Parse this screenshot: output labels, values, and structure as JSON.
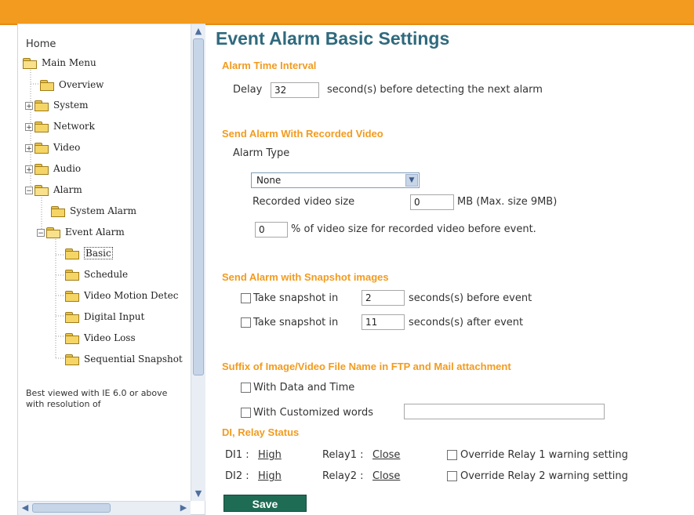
{
  "sidebar": {
    "home": "Home",
    "tree": [
      {
        "label": "Main Menu",
        "expander": ""
      },
      {
        "label": "Overview",
        "expander": ""
      },
      {
        "label": "System",
        "expander": "+"
      },
      {
        "label": "Network",
        "expander": "+"
      },
      {
        "label": "Video",
        "expander": "+"
      },
      {
        "label": "Audio",
        "expander": "+"
      },
      {
        "label": "Alarm",
        "expander": "−"
      },
      {
        "label": "System Alarm",
        "expander": ""
      },
      {
        "label": "Event Alarm",
        "expander": "−"
      },
      {
        "label": "Basic",
        "expander": ""
      },
      {
        "label": "Schedule",
        "expander": ""
      },
      {
        "label": "Video Motion Detec",
        "expander": ""
      },
      {
        "label": "Digital Input",
        "expander": ""
      },
      {
        "label": "Video Loss",
        "expander": ""
      },
      {
        "label": "Sequential Snapshot",
        "expander": ""
      }
    ],
    "note": "Best viewed with IE 6.0 or above with resolution of"
  },
  "main": {
    "title": "Event Alarm Basic Settings",
    "alarm_time": {
      "heading": "Alarm Time Interval",
      "delay_label": "Delay",
      "delay_value": "32",
      "delay_suffix": "second(s) before detecting the next alarm"
    },
    "recorded_video": {
      "heading": "Send Alarm With Recorded Video",
      "alarm_type_label": "Alarm Type",
      "alarm_type_value": "None",
      "size_label": "Recorded video size",
      "size_value": "0",
      "size_suffix": "MB (Max. size 9MB)",
      "percent_value": "0",
      "percent_suffix": "% of video size for recorded video before event."
    },
    "snapshot": {
      "heading": "Send Alarm with Snapshot images",
      "before_label": "Take snapshot in",
      "before_value": "2",
      "before_suffix": "seconds(s) before event",
      "after_label": "Take snapshot in",
      "after_value": "11",
      "after_suffix": "seconds(s) after event"
    },
    "suffix": {
      "heading": "Suffix of Image/Video File Name in FTP and Mail attachment",
      "with_date": "With Data and Time",
      "with_custom": "With Customized words",
      "custom_value": ""
    },
    "relay": {
      "heading": "DI, Relay Status",
      "di1_label": "DI1 :",
      "di1_value": "High",
      "relay1_label": "Relay1 :",
      "relay1_value": "Close",
      "override1": "Override Relay 1 warning setting",
      "di2_label": "DI2 :",
      "di2_value": "High",
      "relay2_label": "Relay2 :",
      "relay2_value": "Close",
      "override2": "Override Relay 2 warning setting"
    },
    "save_label": "Save"
  },
  "colors": {
    "top_bar": "#f29b1f",
    "title": "#2f6a7d",
    "section_heading": "#f29b1f",
    "save_button": "#1f6c55"
  }
}
